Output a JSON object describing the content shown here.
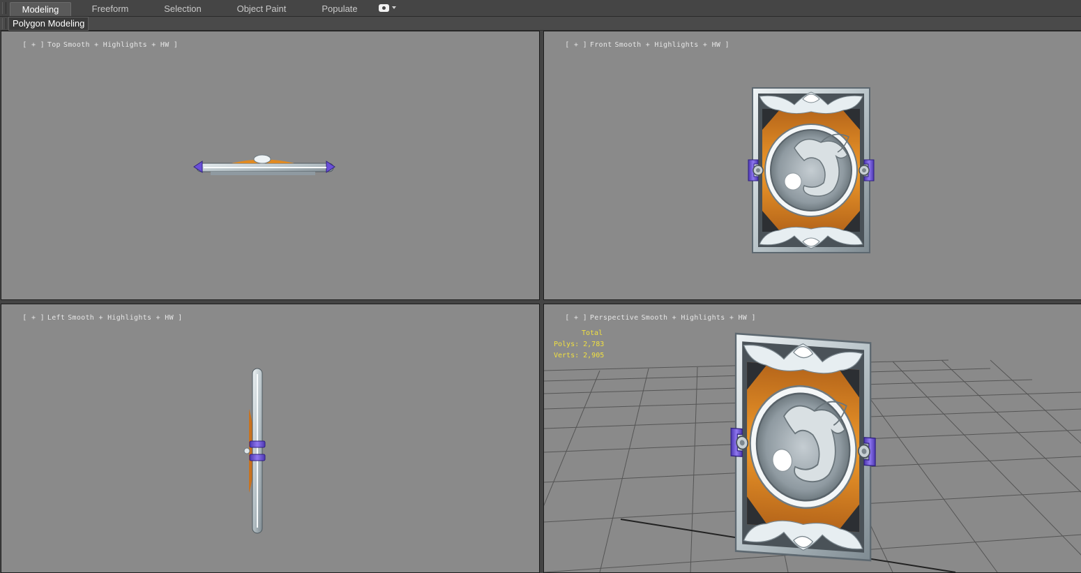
{
  "ribbon": {
    "tabs": [
      {
        "label": "Modeling",
        "active": true
      },
      {
        "label": "Freeform",
        "active": false
      },
      {
        "label": "Selection",
        "active": false
      },
      {
        "label": "Object Paint",
        "active": false
      },
      {
        "label": "Populate",
        "active": false
      }
    ],
    "menu_icon": "eye-dropdown-icon",
    "panel_label": "Polygon Modeling"
  },
  "viewports": {
    "top": {
      "plus": "[ + ]",
      "view": "Top",
      "shading": "Smooth + Highlights + HW ]"
    },
    "front": {
      "plus": "[ + ]",
      "view": "Front",
      "shading": "Smooth + Highlights + HW ]"
    },
    "left": {
      "plus": "[ + ]",
      "view": "Left",
      "shading": "Smooth + Highlights + HW ]"
    },
    "persp": {
      "plus": "[ + ]",
      "view": "Perspective",
      "shading": "Smooth + Highlights + HW ]"
    }
  },
  "stats": {
    "total": "Total",
    "polys": "Polys: 2,783",
    "verts": "Verts: 2,905"
  },
  "colors": {
    "viewport_bg": "#8a8a8a",
    "stats_text": "#f0e040",
    "card_orange": "#e08a22",
    "card_silver": "#c9d2d6",
    "clip_purple": "#6a4fd8"
  }
}
